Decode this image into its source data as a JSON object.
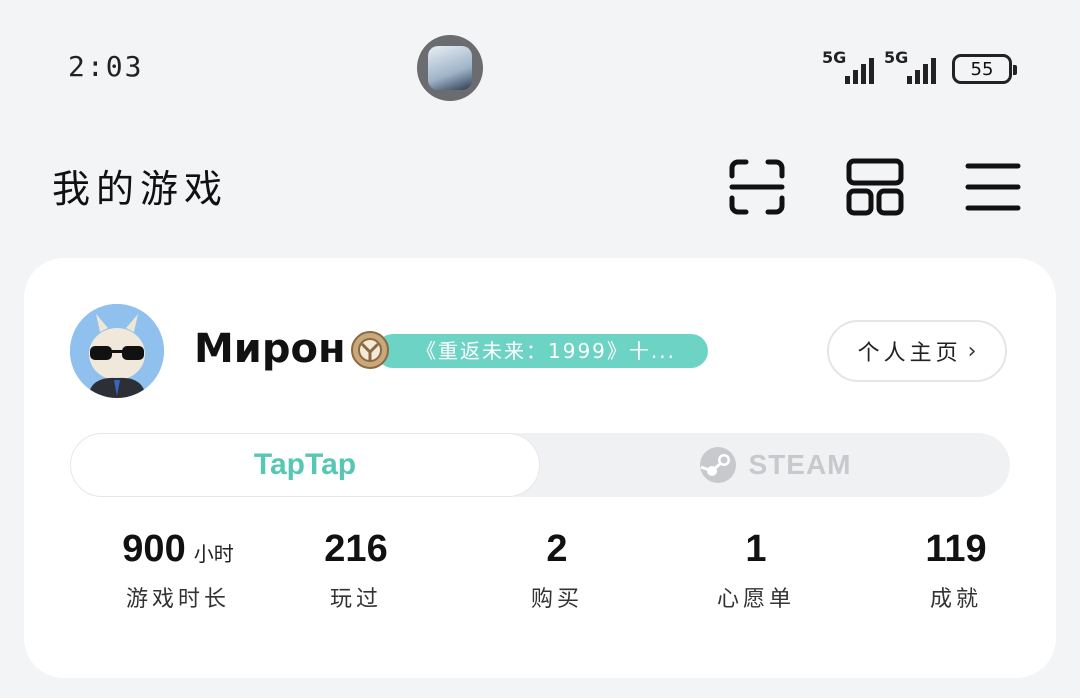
{
  "status_bar": {
    "time": "2:03",
    "signal1": "5G",
    "signal2": "5G",
    "battery": "55"
  },
  "header": {
    "title": "我的游戏",
    "icons": [
      "scan-icon",
      "grid-icon",
      "menu-icon"
    ]
  },
  "profile": {
    "username": "Мирон",
    "badge_text": "《重返未来：1999》十...",
    "profile_button": "个人主页",
    "profile_chevron": "›"
  },
  "tabs": {
    "active": "TapTap",
    "inactive": "STEAM"
  },
  "stats": [
    {
      "value": "900",
      "unit": "小时",
      "label": "游戏时长"
    },
    {
      "value": "216",
      "unit": "",
      "label": "玩过"
    },
    {
      "value": "2",
      "unit": "",
      "label": "购买"
    },
    {
      "value": "1",
      "unit": "",
      "label": "心愿单"
    },
    {
      "value": "119",
      "unit": "",
      "label": "成就"
    }
  ],
  "colors": {
    "accent": "#56c7b3",
    "badge": "#6dd3c4",
    "background": "#f3f4f6"
  }
}
